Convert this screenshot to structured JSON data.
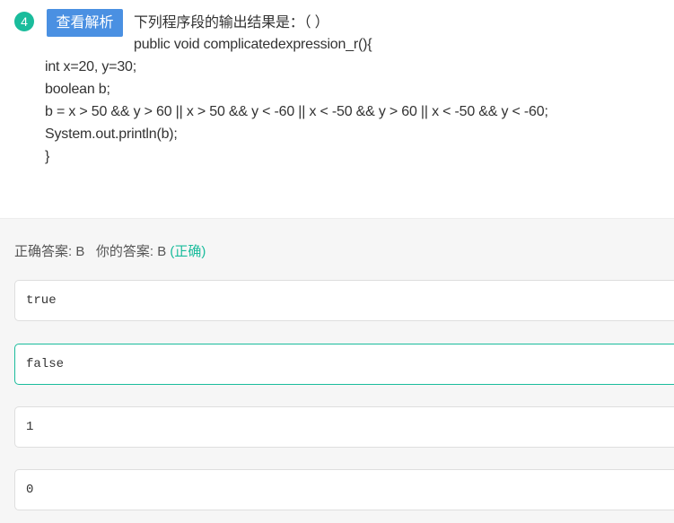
{
  "question": {
    "number": "4",
    "analysis_button": "查看解析",
    "lines": [
      "下列程序段的输出结果是：（ ）",
      "public void complicatedexpression_r(){",
      "int x=20, y=30;",
      "boolean b;",
      "b = x > 50 && y > 60 || x > 50 && y < -60 || x < -50 && y > 60 || x < -50 && y < -60;",
      "System.out.println(b);",
      "}"
    ]
  },
  "answer": {
    "correct_label": "正确答案: ",
    "correct_value": "B",
    "yours_label": "你的答案: ",
    "yours_value": "B",
    "status": "(正确)",
    "status_color": "#1abc9c"
  },
  "options": [
    {
      "text": "true",
      "selected": false
    },
    {
      "text": "false",
      "selected": true
    },
    {
      "text": "1",
      "selected": false
    },
    {
      "text": "0",
      "selected": false
    }
  ],
  "colors": {
    "accent": "#1abc9c",
    "button": "#4a90e2"
  }
}
